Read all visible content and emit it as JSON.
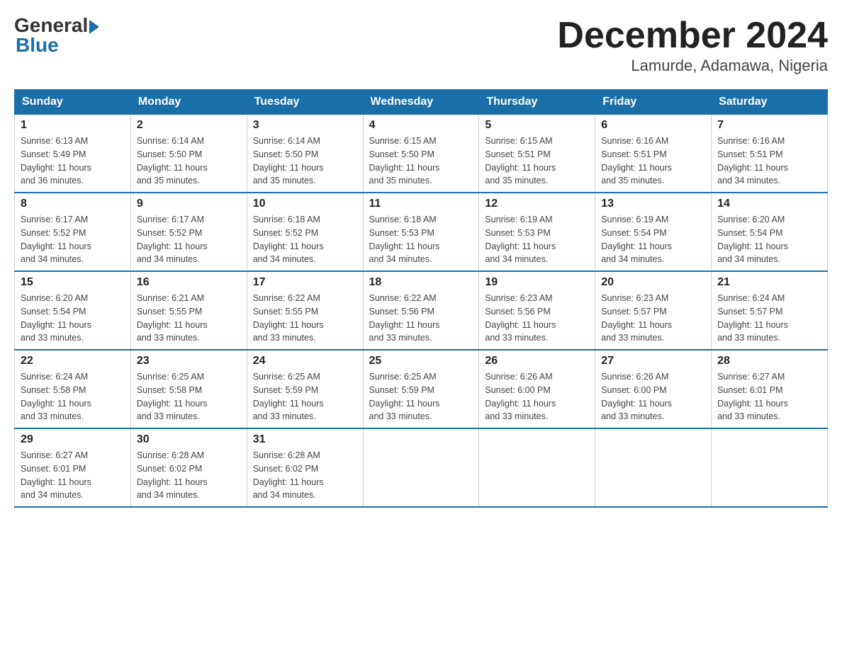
{
  "logo": {
    "general": "General",
    "blue": "Blue"
  },
  "title": "December 2024",
  "location": "Lamurde, Adamawa, Nigeria",
  "weekdays": [
    "Sunday",
    "Monday",
    "Tuesday",
    "Wednesday",
    "Thursday",
    "Friday",
    "Saturday"
  ],
  "weeks": [
    [
      {
        "day": "1",
        "sunrise": "6:13 AM",
        "sunset": "5:49 PM",
        "daylight": "11 hours and 36 minutes."
      },
      {
        "day": "2",
        "sunrise": "6:14 AM",
        "sunset": "5:50 PM",
        "daylight": "11 hours and 35 minutes."
      },
      {
        "day": "3",
        "sunrise": "6:14 AM",
        "sunset": "5:50 PM",
        "daylight": "11 hours and 35 minutes."
      },
      {
        "day": "4",
        "sunrise": "6:15 AM",
        "sunset": "5:50 PM",
        "daylight": "11 hours and 35 minutes."
      },
      {
        "day": "5",
        "sunrise": "6:15 AM",
        "sunset": "5:51 PM",
        "daylight": "11 hours and 35 minutes."
      },
      {
        "day": "6",
        "sunrise": "6:16 AM",
        "sunset": "5:51 PM",
        "daylight": "11 hours and 35 minutes."
      },
      {
        "day": "7",
        "sunrise": "6:16 AM",
        "sunset": "5:51 PM",
        "daylight": "11 hours and 34 minutes."
      }
    ],
    [
      {
        "day": "8",
        "sunrise": "6:17 AM",
        "sunset": "5:52 PM",
        "daylight": "11 hours and 34 minutes."
      },
      {
        "day": "9",
        "sunrise": "6:17 AM",
        "sunset": "5:52 PM",
        "daylight": "11 hours and 34 minutes."
      },
      {
        "day": "10",
        "sunrise": "6:18 AM",
        "sunset": "5:52 PM",
        "daylight": "11 hours and 34 minutes."
      },
      {
        "day": "11",
        "sunrise": "6:18 AM",
        "sunset": "5:53 PM",
        "daylight": "11 hours and 34 minutes."
      },
      {
        "day": "12",
        "sunrise": "6:19 AM",
        "sunset": "5:53 PM",
        "daylight": "11 hours and 34 minutes."
      },
      {
        "day": "13",
        "sunrise": "6:19 AM",
        "sunset": "5:54 PM",
        "daylight": "11 hours and 34 minutes."
      },
      {
        "day": "14",
        "sunrise": "6:20 AM",
        "sunset": "5:54 PM",
        "daylight": "11 hours and 34 minutes."
      }
    ],
    [
      {
        "day": "15",
        "sunrise": "6:20 AM",
        "sunset": "5:54 PM",
        "daylight": "11 hours and 33 minutes."
      },
      {
        "day": "16",
        "sunrise": "6:21 AM",
        "sunset": "5:55 PM",
        "daylight": "11 hours and 33 minutes."
      },
      {
        "day": "17",
        "sunrise": "6:22 AM",
        "sunset": "5:55 PM",
        "daylight": "11 hours and 33 minutes."
      },
      {
        "day": "18",
        "sunrise": "6:22 AM",
        "sunset": "5:56 PM",
        "daylight": "11 hours and 33 minutes."
      },
      {
        "day": "19",
        "sunrise": "6:23 AM",
        "sunset": "5:56 PM",
        "daylight": "11 hours and 33 minutes."
      },
      {
        "day": "20",
        "sunrise": "6:23 AM",
        "sunset": "5:57 PM",
        "daylight": "11 hours and 33 minutes."
      },
      {
        "day": "21",
        "sunrise": "6:24 AM",
        "sunset": "5:57 PM",
        "daylight": "11 hours and 33 minutes."
      }
    ],
    [
      {
        "day": "22",
        "sunrise": "6:24 AM",
        "sunset": "5:58 PM",
        "daylight": "11 hours and 33 minutes."
      },
      {
        "day": "23",
        "sunrise": "6:25 AM",
        "sunset": "5:58 PM",
        "daylight": "11 hours and 33 minutes."
      },
      {
        "day": "24",
        "sunrise": "6:25 AM",
        "sunset": "5:59 PM",
        "daylight": "11 hours and 33 minutes."
      },
      {
        "day": "25",
        "sunrise": "6:25 AM",
        "sunset": "5:59 PM",
        "daylight": "11 hours and 33 minutes."
      },
      {
        "day": "26",
        "sunrise": "6:26 AM",
        "sunset": "6:00 PM",
        "daylight": "11 hours and 33 minutes."
      },
      {
        "day": "27",
        "sunrise": "6:26 AM",
        "sunset": "6:00 PM",
        "daylight": "11 hours and 33 minutes."
      },
      {
        "day": "28",
        "sunrise": "6:27 AM",
        "sunset": "6:01 PM",
        "daylight": "11 hours and 33 minutes."
      }
    ],
    [
      {
        "day": "29",
        "sunrise": "6:27 AM",
        "sunset": "6:01 PM",
        "daylight": "11 hours and 34 minutes."
      },
      {
        "day": "30",
        "sunrise": "6:28 AM",
        "sunset": "6:02 PM",
        "daylight": "11 hours and 34 minutes."
      },
      {
        "day": "31",
        "sunrise": "6:28 AM",
        "sunset": "6:02 PM",
        "daylight": "11 hours and 34 minutes."
      },
      null,
      null,
      null,
      null
    ]
  ],
  "labels": {
    "sunrise": "Sunrise:",
    "sunset": "Sunset:",
    "daylight": "Daylight:"
  },
  "colors": {
    "header_bg": "#1a6fa8",
    "header_text": "#ffffff",
    "border": "#1a6fa8"
  }
}
